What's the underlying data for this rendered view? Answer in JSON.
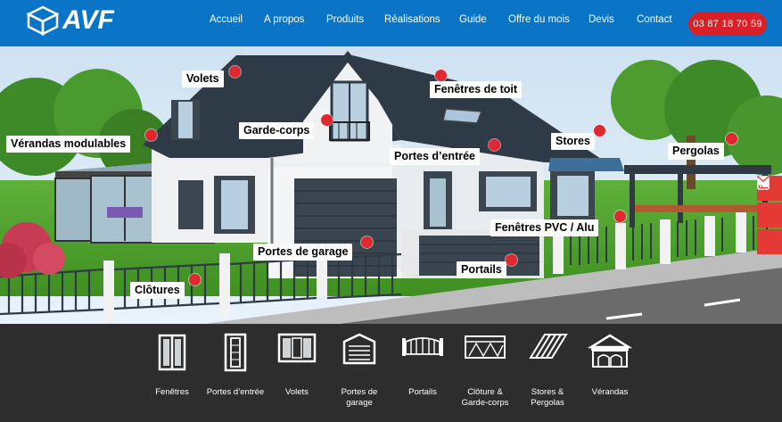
{
  "header": {
    "logo_text": "AVF",
    "nav": [
      {
        "label": "Accueil"
      },
      {
        "label": "A propos"
      },
      {
        "label": "Produits"
      },
      {
        "label": "Réalisations"
      },
      {
        "label": "Guide"
      },
      {
        "label": "Offre du mois"
      },
      {
        "label": "Devis"
      },
      {
        "label": "Contact"
      }
    ],
    "phone": "03 87 18 70 59"
  },
  "hero": {
    "hotspots": [
      {
        "label": "Volets"
      },
      {
        "label": "Fenêtres de toit"
      },
      {
        "label": "Garde-corps"
      },
      {
        "label": "Vérandas modulables"
      },
      {
        "label": "Stores"
      },
      {
        "label": "Portes d’entrée"
      },
      {
        "label": "Pergolas"
      },
      {
        "label": "Fenêtres PVC / Alu"
      },
      {
        "label": "Portes de garage"
      },
      {
        "label": "Portails"
      },
      {
        "label": "Clôtures"
      }
    ]
  },
  "side_buttons": [
    {
      "icon": "calculator-icon"
    },
    {
      "icon": "phone-icon"
    },
    {
      "icon": "envelope-icon"
    }
  ],
  "categories": [
    {
      "label": "Fenêtres",
      "icon": "window-icon"
    },
    {
      "label": "Portes d’entrée",
      "icon": "door-icon"
    },
    {
      "label": "Volets",
      "icon": "shutters-icon"
    },
    {
      "label": "Portes de garage",
      "icon": "garage-door-icon"
    },
    {
      "label": "Portails",
      "icon": "gate-icon"
    },
    {
      "label": "Clôture & Garde-corps",
      "icon": "fence-icon"
    },
    {
      "label": "Stores & Pergolas",
      "icon": "awning-icon"
    },
    {
      "label": "Vérandas",
      "icon": "veranda-icon"
    }
  ],
  "colors": {
    "header": "#0a74c6",
    "accent": "#d92027",
    "footer": "#2d2d2d"
  }
}
